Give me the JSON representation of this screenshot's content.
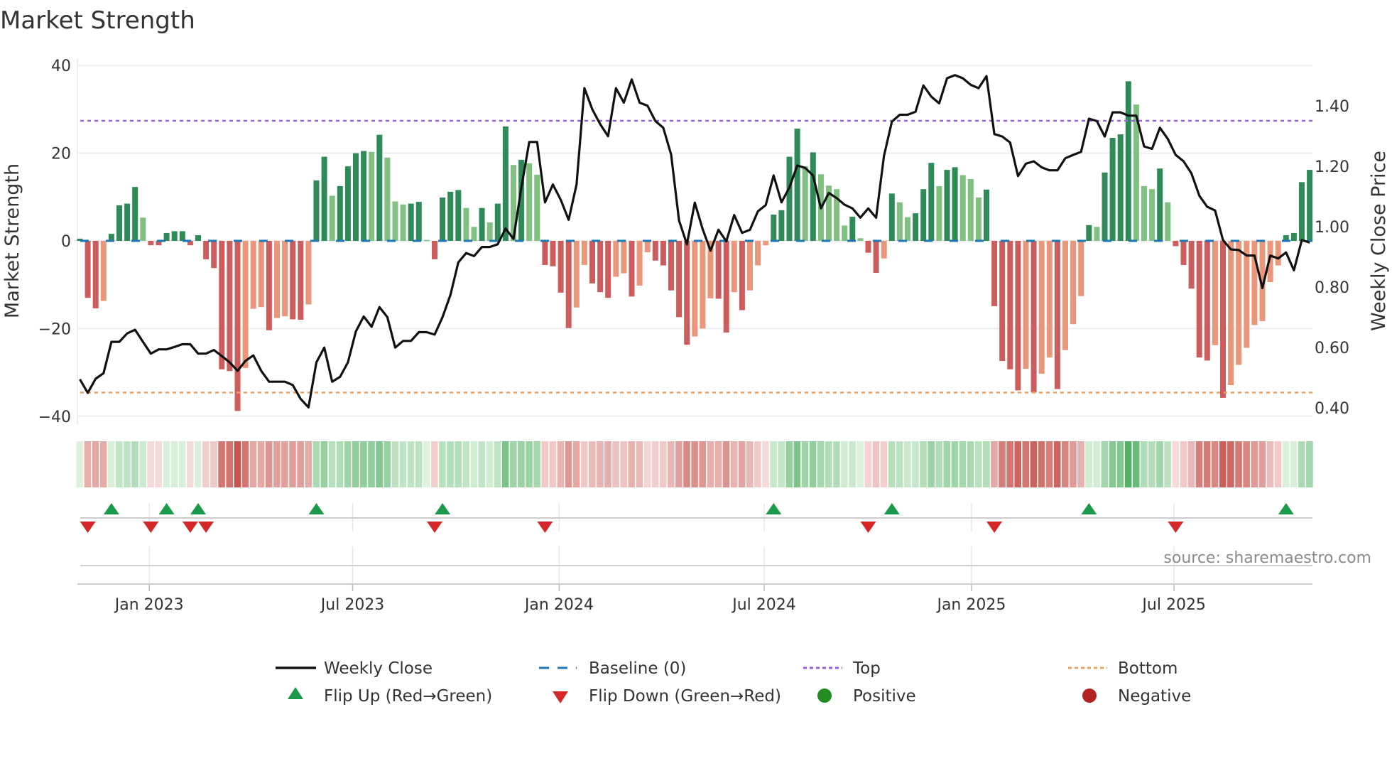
{
  "title": "Market Strength",
  "source": "source: sharemaestro.com",
  "colors": {
    "pos_up": "#2e8b57",
    "pos_down": "#80c080",
    "neg_down": "#cd5c5c",
    "neg_up": "#e9967a",
    "line": "#111111",
    "baseline": "#1f77b4",
    "top": "#9b5fe0",
    "bottom": "#f0a060",
    "flip_up": "#1a9a4a",
    "flip_down": "#d62728",
    "positive": "#228b22",
    "negative": "#b22222"
  },
  "legend": {
    "weekly_close": "Weekly Close",
    "baseline": "Baseline (0)",
    "top": "Top",
    "bottom": "Bottom",
    "flip_up": "Flip Up (Red→Green)",
    "flip_down": "Flip Down (Green→Red)",
    "positive": "Positive",
    "negative": "Negative"
  },
  "chart_data": {
    "type": "bar+line",
    "title": "Market Strength",
    "ylabel": "Market Strength",
    "y2label": "Weekly Close Price",
    "ylim": [
      -42,
      42
    ],
    "y2lim": [
      0.3,
      1.53
    ],
    "yticks": [
      "40",
      "20",
      "0",
      "−20",
      "−40"
    ],
    "ytick_values": [
      40,
      20,
      0,
      -20,
      -40
    ],
    "y2ticks": [
      "1.40",
      "1.20",
      "1.00",
      "0.80",
      "0.60",
      "0.40"
    ],
    "y2tick_values": [
      1.4,
      1.2,
      1.0,
      0.8,
      0.6,
      0.4
    ],
    "xticks": [
      {
        "label": "Jan 2023",
        "week": 8.8
      },
      {
        "label": "Jul 2023",
        "week": 34.6
      },
      {
        "label": "Jan 2024",
        "week": 60.8
      },
      {
        "label": "Jul 2024",
        "week": 86.8
      },
      {
        "label": "Jan 2025",
        "week": 113.1
      },
      {
        "label": "Jul 2025",
        "week": 138.8
      }
    ],
    "top_level": 27.4,
    "bottom_level": -34.6,
    "baseline": 0,
    "strength": [
      0.5,
      -13.0,
      -15.4,
      -13.7,
      1.6,
      8.1,
      8.5,
      12.3,
      5.3,
      -1.0,
      -1.0,
      1.8,
      2.2,
      2.2,
      -1.0,
      1.3,
      -4.2,
      -6.2,
      -29.3,
      -29.7,
      -38.8,
      -29.0,
      -15.5,
      -15.1,
      -20.4,
      -17.6,
      -17.2,
      -17.9,
      -18.0,
      -14.5,
      13.8,
      19.2,
      10.3,
      12.5,
      17.0,
      20.0,
      20.5,
      20.3,
      24.2,
      19.0,
      9.0,
      8.3,
      8.5,
      8.9,
      0.2,
      -4.2,
      9.9,
      11.2,
      11.6,
      7.5,
      3.2,
      7.5,
      4.2,
      8.5,
      26.1,
      17.3,
      18.5,
      17.7,
      15.1,
      -5.5,
      -5.8,
      -11.8,
      -19.9,
      -15.2,
      -5.5,
      -9.7,
      -11.7,
      -13.0,
      -8.2,
      -7.4,
      -12.7,
      -10.2,
      -2.6,
      -4.5,
      -5.6,
      -11.3,
      -17.4,
      -23.7,
      -21.8,
      -20.0,
      -13.1,
      -13.2,
      -20.9,
      -11.7,
      -15.8,
      -11.3,
      -5.6,
      -1.0,
      6.0,
      7.0,
      19.2,
      25.6,
      17.0,
      20.2,
      15.2,
      12.6,
      11.8,
      3.5,
      5.5,
      0.6,
      -2.7,
      -7.3,
      -4.0,
      10.8,
      8.8,
      5.4,
      6.3,
      11.8,
      17.8,
      12.5,
      16.2,
      16.8,
      15.0,
      14.1,
      9.9,
      11.7,
      -14.9,
      -27.4,
      -29.3,
      -34.1,
      -29.2,
      -34.6,
      -30.3,
      -26.6,
      -33.8,
      -24.9,
      -19.0,
      -12.6,
      3.6,
      3.2,
      15.6,
      23.5,
      24.3,
      36.4,
      31.1,
      12.5,
      11.8,
      16.5,
      8.8,
      -1.2,
      -5.5,
      -10.9,
      -26.6,
      -27.3,
      -23.8,
      -35.8,
      -32.9,
      -28.3,
      -24.4,
      -19.2,
      -18.3,
      -9.4,
      -5.6,
      1.3,
      1.8,
      13.4,
      16.2
    ],
    "weekly_close": [
      0.494,
      0.449,
      0.496,
      0.514,
      0.618,
      0.618,
      0.646,
      0.658,
      0.618,
      0.579,
      0.593,
      0.593,
      0.601,
      0.61,
      0.61,
      0.579,
      0.579,
      0.591,
      0.571,
      0.55,
      0.522,
      0.555,
      0.573,
      0.522,
      0.486,
      0.486,
      0.486,
      0.475,
      0.429,
      0.401,
      0.55,
      0.599,
      0.486,
      0.502,
      0.55,
      0.652,
      0.702,
      0.668,
      0.733,
      0.7,
      0.599,
      0.621,
      0.621,
      0.65,
      0.65,
      0.642,
      0.7,
      0.773,
      0.881,
      0.912,
      0.902,
      0.932,
      0.932,
      0.941,
      0.993,
      0.959,
      1.129,
      1.28,
      1.28,
      1.08,
      1.139,
      1.088,
      1.022,
      1.139,
      1.458,
      1.388,
      1.339,
      1.299,
      1.458,
      1.41,
      1.487,
      1.41,
      1.4,
      1.349,
      1.327,
      1.238,
      1.02,
      0.941,
      1.079,
      0.991,
      0.92,
      0.989,
      0.951,
      1.038,
      0.979,
      0.989,
      1.05,
      1.071,
      1.169,
      1.08,
      1.129,
      1.202,
      1.194,
      1.169,
      1.06,
      1.111,
      1.094,
      1.072,
      1.06,
      1.029,
      1.06,
      1.029,
      1.234,
      1.347,
      1.37,
      1.37,
      1.38,
      1.467,
      1.43,
      1.408,
      1.491,
      1.501,
      1.491,
      1.469,
      1.458,
      1.498,
      1.306,
      1.298,
      1.278,
      1.167,
      1.208,
      1.216,
      1.196,
      1.186,
      1.186,
      1.226,
      1.237,
      1.247,
      1.357,
      1.349,
      1.298,
      1.378,
      1.378,
      1.367,
      1.367,
      1.265,
      1.257,
      1.327,
      1.29,
      1.237,
      1.216,
      1.176,
      1.102,
      1.065,
      1.053,
      0.955,
      0.924,
      0.922,
      0.904,
      0.904,
      0.796,
      0.904,
      0.894,
      0.914,
      0.855,
      0.955,
      0.947
    ],
    "flips_up": [
      4,
      11,
      15,
      30,
      46,
      88,
      103,
      128,
      153
    ],
    "flips_down": [
      1,
      9,
      14,
      16,
      45,
      59,
      100,
      116,
      139
    ]
  }
}
